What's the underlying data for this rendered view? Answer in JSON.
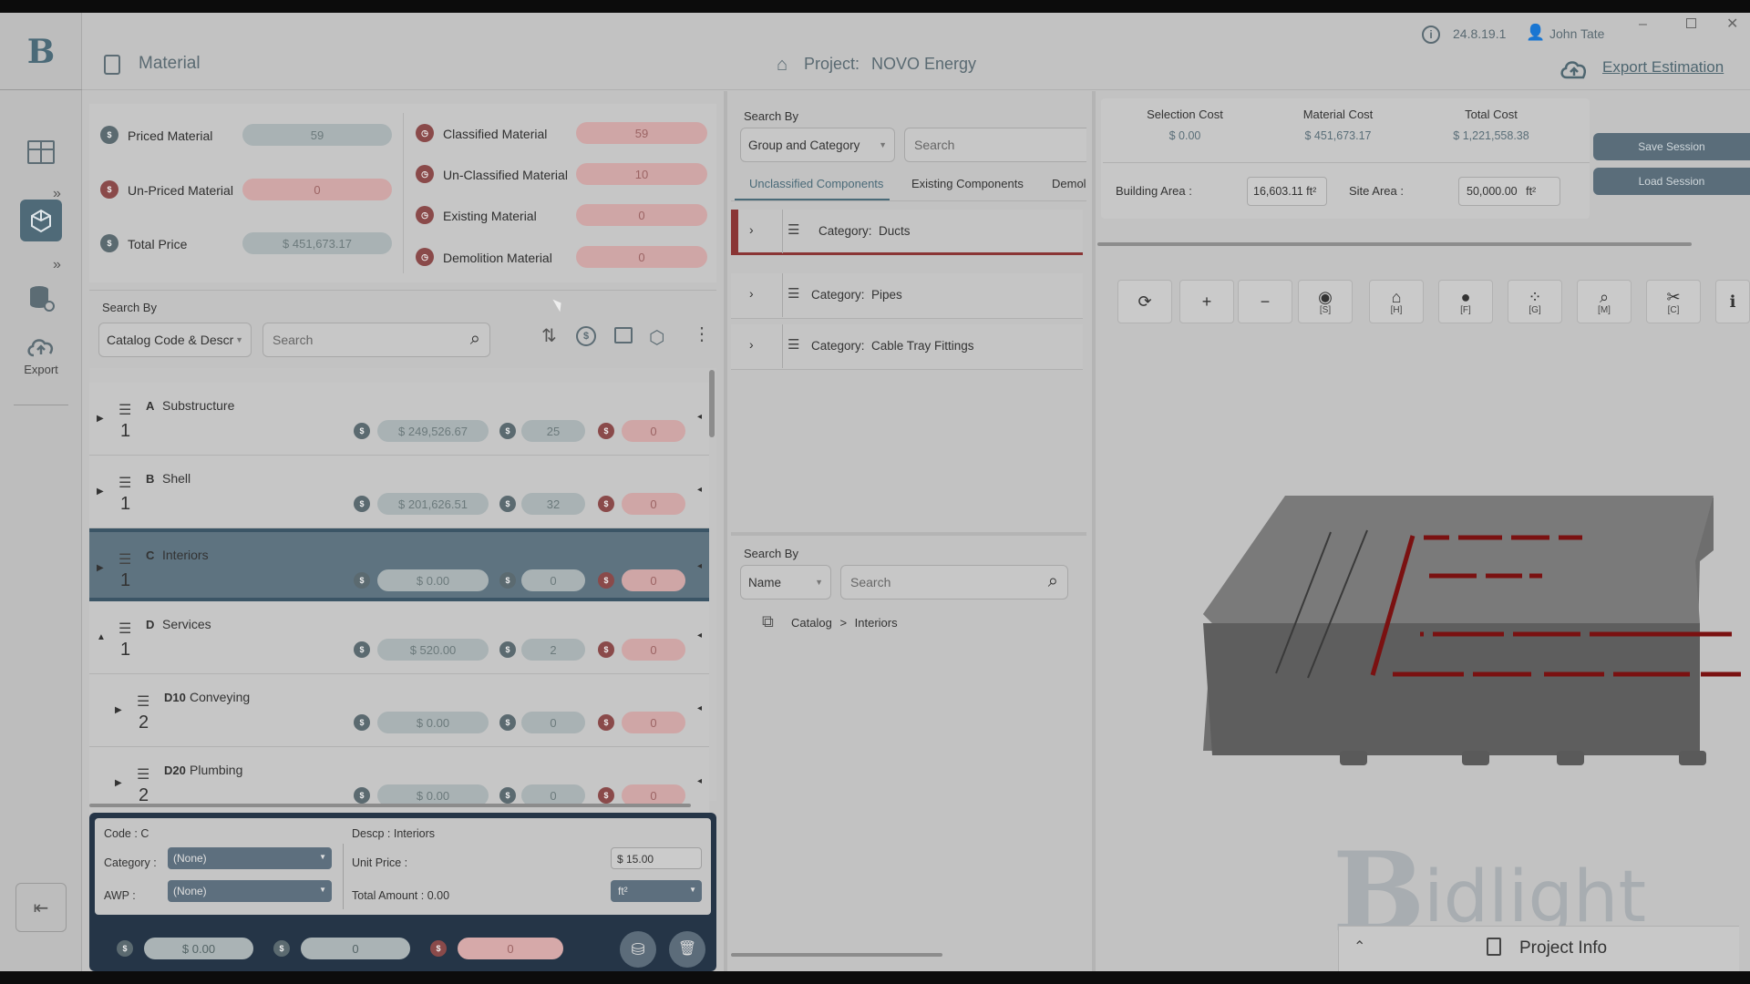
{
  "header": {
    "module": "Material",
    "project_label": "Project:",
    "project_name": "NOVO Energy",
    "version": "24.8.19.1",
    "user": "John Tate",
    "export_label": "Export Estimation"
  },
  "rail": {
    "export_label": "Export"
  },
  "summary": {
    "priced_label": "Priced Material",
    "priced_value": "59",
    "unpriced_label": "Un-Priced Material",
    "unpriced_value": "0",
    "total_label": "Total Price",
    "total_value": "$ 451,673.17",
    "classified_label": "Classified Material",
    "classified_value": "59",
    "unclassified_label": "Un-Classified Material",
    "unclassified_value": "10",
    "existing_label": "Existing Material",
    "existing_value": "0",
    "demolition_label": "Demolition Material",
    "demolition_value": "0"
  },
  "left_search": {
    "label": "Search By",
    "mode": "Catalog Code & Descr",
    "placeholder": "Search"
  },
  "tree": [
    {
      "code": "A",
      "name": "Substructure",
      "level": "1",
      "price": "$ 249,526.67",
      "count": "25",
      "flag": "0"
    },
    {
      "code": "B",
      "name": "Shell",
      "level": "1",
      "price": "$ 201,626.51",
      "count": "32",
      "flag": "0"
    },
    {
      "code": "C",
      "name": "Interiors",
      "level": "1",
      "price": "$ 0.00",
      "count": "0",
      "flag": "0"
    },
    {
      "code": "D",
      "name": "Services",
      "level": "1",
      "price": "$ 520.00",
      "count": "2",
      "flag": "0"
    },
    {
      "code": "D10",
      "name": "Conveying",
      "level": "2",
      "price": "$ 0.00",
      "count": "0",
      "flag": "0"
    },
    {
      "code": "D20",
      "name": "Plumbing",
      "level": "2",
      "price": "$ 0.00",
      "count": "0",
      "flag": "0"
    }
  ],
  "detail": {
    "code_label": "Code :",
    "code": "C",
    "descp_label": "Descp :",
    "descp": "Interiors",
    "category_label": "Category :",
    "category": "(None)",
    "awp_label": "AWP :",
    "awp": "(None)",
    "unit_price_label": "Unit Price :",
    "unit_price": "$ 15.00",
    "total_amount_label": "Total Amount :",
    "total_amount": "0.00",
    "unit": "ft²",
    "footer_price": "$ 0.00",
    "footer_count": "0",
    "footer_flag": "0"
  },
  "mid": {
    "search_label": "Search By",
    "mode": "Group and Category",
    "placeholder": "Search",
    "tabs": [
      "Unclassified Components",
      "Existing Components",
      "Demol"
    ],
    "categories": [
      {
        "label": "Category:",
        "name": "Ducts"
      },
      {
        "label": "Category:",
        "name": "Pipes"
      },
      {
        "label": "Category:",
        "name": "Cable Tray Fittings"
      }
    ],
    "search2_label": "Search By",
    "mode2": "Name",
    "placeholder2": "Search",
    "breadcrumb_root": "Catalog",
    "breadcrumb_sep": ">",
    "breadcrumb_leaf": "Interiors"
  },
  "right": {
    "selection_cost_label": "Selection Cost",
    "selection_cost": "$ 0.00",
    "material_cost_label": "Material Cost",
    "material_cost": "$ 451,673.17",
    "total_cost_label": "Total Cost",
    "total_cost": "$ 1,221,558.38",
    "save_session": "Save Session",
    "load_session": "Load Session",
    "building_area_label": "Building Area :",
    "building_area": "16,603.11",
    "site_area_label": "Site Area :",
    "site_area": "50,000.00",
    "area_unit": "ft²",
    "toolbar_keys": [
      "[S]",
      "[H]",
      "[F]",
      "[G]",
      "[M]",
      "[C]"
    ],
    "watermark": "idlight",
    "project_info": "Project Info"
  }
}
